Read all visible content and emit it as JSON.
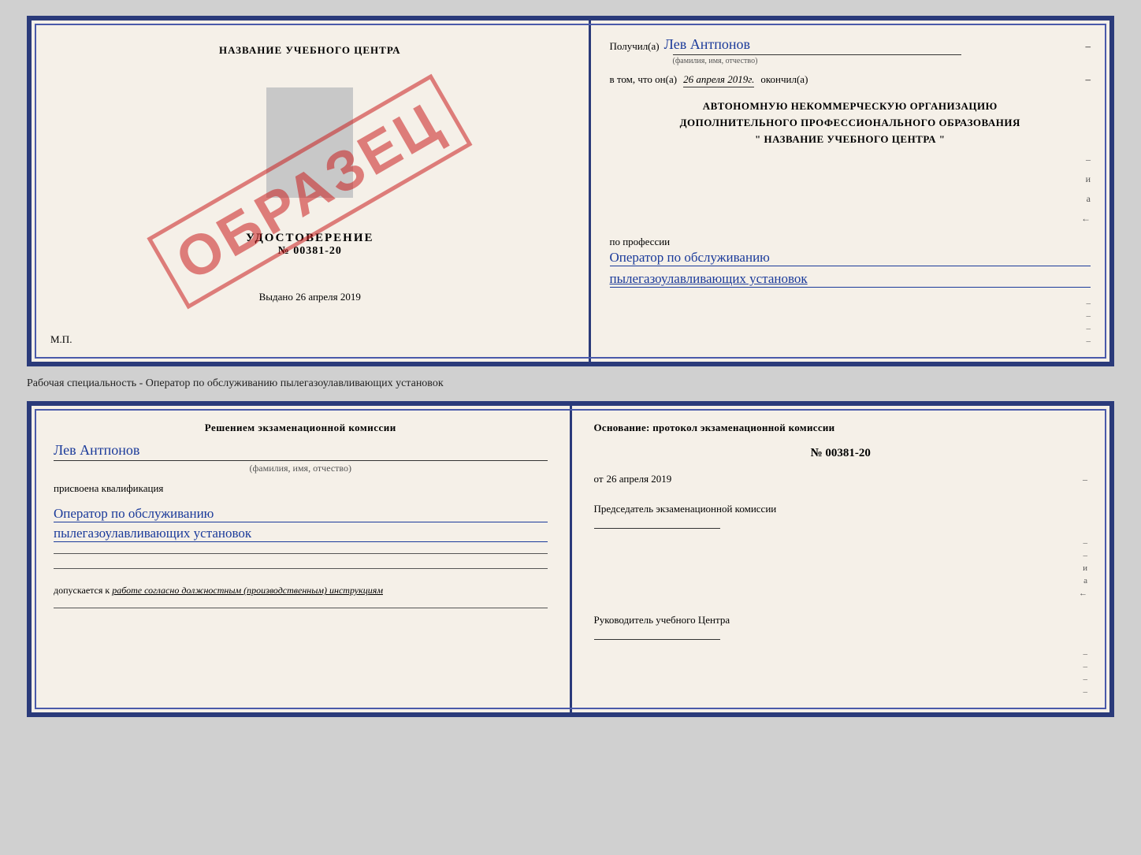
{
  "top_cert": {
    "left": {
      "school_name": "НАЗВАНИЕ УЧЕБНОГО ЦЕНТРА",
      "stamp_text": "ОБРАЗЕЦ",
      "udostoverenie_title": "УДОСТОВЕРЕНИЕ",
      "cert_number": "№ 00381-20",
      "vydano_label": "Выдано",
      "vydano_date": "26 апреля 2019",
      "mp_label": "М.П."
    },
    "right": {
      "received_label": "Получил(а)",
      "received_name": "Лев Антпонов",
      "fio_hint": "(фамилия, имя, отчество)",
      "dash": "–",
      "date_prefix": "в том, что он(а)",
      "date_value": "26 апреля 2019г.",
      "date_suffix": "окончил(а)",
      "org_line1": "АВТОНОМНУЮ НЕКОММЕРЧЕСКУЮ ОРГАНИЗАЦИЮ",
      "org_line2": "ДОПОЛНИТЕЛЬНОГО ПРОФЕССИОНАЛЬНОГО ОБРАЗОВАНИЯ",
      "org_line3": "\"  НАЗВАНИЕ УЧЕБНОГО ЦЕНТРА  \"",
      "profession_label": "по профессии",
      "profession_line1": "Оператор по обслуживанию",
      "profession_line2": "пылегазоулавливающих установок"
    }
  },
  "separator": {
    "text": "Рабочая специальность - Оператор по обслуживанию пылегазоулавливающих установок"
  },
  "bottom_cert": {
    "left": {
      "decision_text": "Решением экзаменационной комиссии",
      "person_name": "Лев Антпонов",
      "fio_hint": "(фамилия, имя, отчество)",
      "assigned_text": "присвоена квалификация",
      "qual_line1": "Оператор по обслуживанию",
      "qual_line2": "пылегазоулавливающих установок",
      "допускается_label": "допускается к",
      "допускается_value": "работе согласно должностным (производственным) инструкциям"
    },
    "right": {
      "osnov_text": "Основание: протокол экзаменационной комиссии",
      "protocol_number": "№ 00381-20",
      "protocol_date_prefix": "от",
      "protocol_date_value": "26 апреля 2019",
      "chairman_label": "Председатель экзаменационной комиссии",
      "head_label": "Руководитель учебного Центра"
    }
  },
  "side_dashes": [
    "–",
    "–",
    "–",
    "и",
    "а",
    "←",
    "–",
    "–",
    "–",
    "–"
  ],
  "side_dashes2": [
    "–",
    "–",
    "–",
    "и",
    "а",
    "←",
    "–",
    "–",
    "–",
    "–"
  ]
}
